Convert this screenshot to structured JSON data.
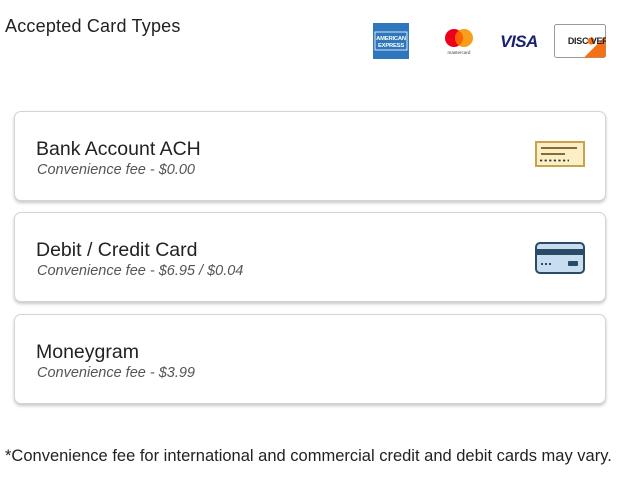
{
  "header": {
    "title": "Accepted Card Types",
    "cards": {
      "amex": "AMERICAN EXPRESS",
      "mastercard": "mastercard",
      "visa": "VISA",
      "discover": "DISCOVER"
    }
  },
  "options": [
    {
      "title": "Bank Account ACH",
      "fee": "Convenience fee - $0.00",
      "icon": "check-icon"
    },
    {
      "title": "Debit / Credit Card",
      "fee": "Convenience fee - $6.95 / $0.04",
      "icon": "credit-card-icon"
    },
    {
      "title": "Moneygram",
      "fee": "Convenience fee - $3.99",
      "icon": ""
    }
  ],
  "footnote": "*Convenience fee for international and commercial credit and debit cards may vary.",
  "colors": {
    "amex_blue": "#2E77BC",
    "mc_red": "#EB001B",
    "mc_orange": "#F79E1B",
    "visa_blue": "#1A1F71",
    "discover_orange": "#F47216",
    "check_gold": "#C9A24A",
    "card_navy": "#2B4A66"
  }
}
